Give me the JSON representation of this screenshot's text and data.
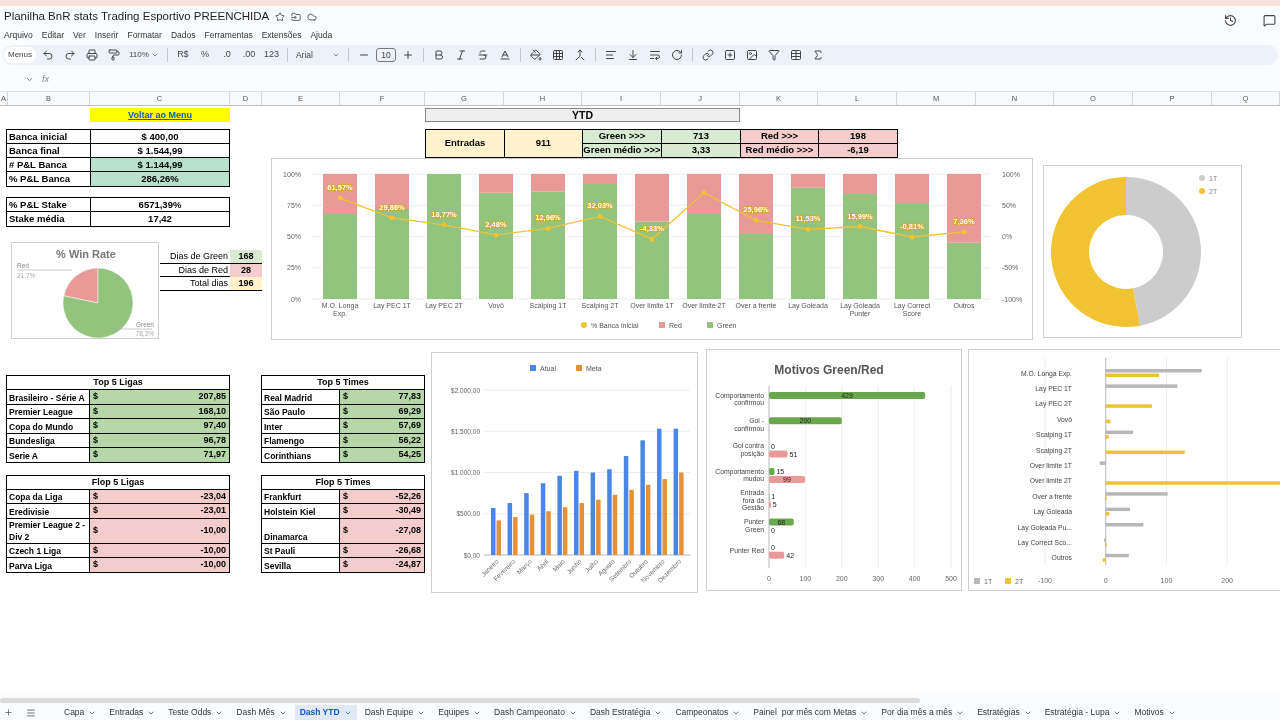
{
  "title": "Planilha BnR stats Trading Esportivo PREENCHIDA",
  "menu": [
    "Arquivo",
    "Editar",
    "Ver",
    "Inserir",
    "Formatar",
    "Dados",
    "Ferramentas",
    "Extensões",
    "Ajuda"
  ],
  "toolbar": {
    "menus": "Menus",
    "zoom": "110%",
    "currency": "R$",
    "percent": "%",
    "dec_less": ".0",
    "dec_more": ".00",
    "format": "123",
    "font": "Arial",
    "size": "10"
  },
  "formula_bar": {
    "label": "fx"
  },
  "columns": [
    "A",
    "B",
    "C",
    "D",
    "E",
    "F",
    "G",
    "H",
    "I",
    "J",
    "K",
    "L",
    "M",
    "N",
    "O",
    "P",
    "Q"
  ],
  "menu_link": "Voltar ao Menu",
  "bank_table": [
    {
      "label": "Banca inicial",
      "value": "$ 400,00",
      "highlight": false
    },
    {
      "label": "Banca final",
      "value": "$ 1.544,99",
      "highlight": false
    },
    {
      "label": "# P&L Banca",
      "value": "$ 1.144,99",
      "highlight": true
    },
    {
      "label": "% P&L Banca",
      "value": "286,26%",
      "highlight": true
    }
  ],
  "stake_table": [
    {
      "label": "% P&L Stake",
      "value": "6571,39%",
      "highlight": false
    },
    {
      "label": "Stake média",
      "value": "17,42",
      "highlight": false
    }
  ],
  "days_table": [
    {
      "label": "Dias de Green",
      "value": "168",
      "color": "#d9ead3"
    },
    {
      "label": "Dias de Red",
      "value": "28",
      "color": "#f4cccc"
    },
    {
      "label": "Total dias",
      "value": "196",
      "color": "#fff2cc"
    }
  ],
  "ytd": {
    "title": "YTD",
    "entries_label": "Entradas",
    "entries_value": "911",
    "green": [
      {
        "label": "Green >>>",
        "value": "713"
      },
      {
        "label": "Green médio >>>",
        "value": "3,33"
      }
    ],
    "red": [
      {
        "label": "Red >>>",
        "value": "198"
      },
      {
        "label": "Red médio >>>",
        "value": "-6,19"
      }
    ]
  },
  "win_rate": {
    "chart_data": {
      "type": "pie",
      "title": "% Win Rate",
      "categories": [
        "Red",
        "Green"
      ],
      "values": [
        21.7,
        78.3
      ],
      "value_labels": [
        "21,7%",
        "78,3%"
      ],
      "colors": [
        "#ea9999",
        "#93c47d"
      ]
    }
  },
  "main_chart": {
    "chart_data": {
      "type": "bar",
      "stacked": true,
      "categories": [
        "M.O. Longa Exp.",
        "Lay PEC 1T",
        "Lay PEC 2T",
        "Vovô",
        "Scalping 1T",
        "Scalping 2T",
        "Over limite 1T",
        "Over limite 2T",
        "Over a frente",
        "Lay Goleada",
        "Lay Goleada Punter",
        "Lay Correct Score",
        "Outros"
      ],
      "series": [
        {
          "name": "% Banca inicial",
          "type": "line",
          "axis": "y2",
          "color": "#f1c232",
          "values": [
            61.57,
            29.86,
            18.77,
            2.48,
            12.96,
            32.03,
            -4.33,
            70,
            25.96,
            11.53,
            15.99,
            -0.81,
            7.36
          ],
          "value_labels": [
            "61,57%",
            "29,86%",
            "18,77%",
            "2,48%",
            "12,96%",
            "32,03%",
            "-4,33%",
            null,
            "25,96%",
            "11,53%",
            "15,99%",
            "-0,81%",
            "7,36%"
          ]
        },
        {
          "name": "Red",
          "type": "bar",
          "color": "#ea9999",
          "values": [
            32,
            28,
            0,
            15,
            14,
            8,
            38,
            32,
            48,
            11,
            16,
            24,
            55
          ]
        },
        {
          "name": "Green",
          "type": "bar",
          "color": "#93c47d",
          "values": [
            68,
            72,
            100,
            85,
            86,
            92,
            62,
            68,
            52,
            89,
            84,
            76,
            45
          ]
        }
      ],
      "grid": true,
      "legend": true,
      "ylim": [
        0,
        100
      ],
      "yticks": [
        {
          "value": 0,
          "label": "0%"
        },
        {
          "value": 25,
          "label": "25%"
        },
        {
          "value": 50,
          "label": "50%"
        },
        {
          "value": 75,
          "label": "75%"
        },
        {
          "value": 100,
          "label": "100%"
        }
      ],
      "y2lim": [
        -100,
        100
      ],
      "y2ticks": [
        {
          "value": -100,
          "label": "-100%"
        },
        {
          "value": -50,
          "label": "-50%"
        },
        {
          "value": 0,
          "label": "0%"
        },
        {
          "value": 50,
          "label": "50%"
        },
        {
          "value": 100,
          "label": "100%"
        }
      ]
    }
  },
  "donut": {
    "legend": [
      {
        "label": "1T",
        "color": "#cccccc"
      },
      {
        "label": "2T",
        "color": "#f1c232"
      }
    ]
  },
  "top_tables": [
    {
      "title": "Top 5 Ligas",
      "kind": "top",
      "rows": [
        {
          "name": "Brasileiro - Série A",
          "currency": "$",
          "value": "207,85"
        },
        {
          "name": "Premier League",
          "currency": "$",
          "value": "168,10"
        },
        {
          "name": "Copa do Mundo",
          "currency": "$",
          "value": "97,40"
        },
        {
          "name": "Bundesliga",
          "currency": "$",
          "value": "96,78"
        },
        {
          "name": "Serie A",
          "currency": "$",
          "value": "71,97"
        }
      ]
    },
    {
      "title": "Top 5 Times",
      "kind": "top",
      "rows": [
        {
          "name": "Real Madrid",
          "currency": "$",
          "value": "77,83"
        },
        {
          "name": "São Paulo",
          "currency": "$",
          "value": "69,29"
        },
        {
          "name": "Inter",
          "currency": "$",
          "value": "57,69"
        },
        {
          "name": "Flamengo",
          "currency": "$",
          "value": "56,22"
        },
        {
          "name": "Corinthians",
          "currency": "$",
          "value": "54,25"
        }
      ]
    }
  ],
  "flop_tables": [
    {
      "title": "Flop 5 Ligas",
      "kind": "flop",
      "rows": [
        {
          "name": "Copa da Liga",
          "currency": "$",
          "value": "-23,04"
        },
        {
          "name": "Eredivisie",
          "currency": "$",
          "value": "-23,01"
        },
        {
          "name": "Premier League 2 - Div 2",
          "currency": "$",
          "value": "-10,00"
        },
        {
          "name": "Czech 1 Liga",
          "currency": "$",
          "value": "-10,00"
        },
        {
          "name": "Parva Liga",
          "currency": "$",
          "value": "-10,00"
        }
      ]
    },
    {
      "title": "Flop 5 Times",
      "kind": "flop",
      "rows": [
        {
          "name": "Frankfurt",
          "currency": "$",
          "value": "-52,26"
        },
        {
          "name": "Holstein Kiel",
          "currency": "$",
          "value": "-30,49"
        },
        {
          "name": "Dinamarca",
          "currency": "$",
          "value": "-27,08"
        },
        {
          "name": "St Pauli",
          "currency": "$",
          "value": "-26,68"
        },
        {
          "name": "Sevilla",
          "currency": "$",
          "value": "-24,87"
        }
      ]
    }
  ],
  "monthly_chart": {
    "chart_data": {
      "type": "bar",
      "categories": [
        "Janeiro",
        "Fevereiro",
        "Março",
        "Abril",
        "Maio",
        "Junho",
        "Julho",
        "Agosto",
        "Setembro",
        "Outubro",
        "Novembro",
        "Dezembro"
      ],
      "series": [
        {
          "name": "Atual",
          "color": "#4a86e8",
          "values": [
            570,
            630,
            750,
            870,
            960,
            1020,
            1000,
            1040,
            1200,
            1390,
            1530,
            1530
          ]
        },
        {
          "name": "Meta",
          "color": "#e69138",
          "values": [
            420,
            460,
            490,
            530,
            580,
            630,
            670,
            730,
            790,
            850,
            920,
            1000
          ]
        }
      ],
      "grid": true,
      "legend": true,
      "ylim": [
        0,
        2000
      ],
      "yticks": [
        {
          "value": 0,
          "label": "$0,00"
        },
        {
          "value": 500,
          "label": "$500,00"
        },
        {
          "value": 1000,
          "label": "$1.000,00"
        },
        {
          "value": 1500,
          "label": "$1.500,00"
        },
        {
          "value": 2000,
          "label": "$2.000,00"
        }
      ]
    }
  },
  "motivos_chart": {
    "chart_data": {
      "type": "bar",
      "orientation": "horizontal",
      "title": "Motivos Green/Red",
      "data_labels": true,
      "categories": [
        "Comportamento confirmou",
        "Gol - confirmou",
        "Gol contra posição",
        "Comportamento mudou",
        "Entrada fora da Gestão",
        "Punter Green",
        "Punter Red"
      ],
      "series": [
        {
          "color": "#6aa84f",
          "values": [
            429,
            200,
            0,
            15,
            1,
            68,
            0
          ]
        },
        {
          "color": "#ea9999",
          "values": [
            null,
            null,
            51,
            99,
            5,
            0,
            42
          ]
        }
      ],
      "grid": true,
      "xlim": [
        0,
        500
      ],
      "xticks": [
        0,
        100,
        200,
        300,
        400,
        500
      ]
    }
  },
  "half_chart": {
    "chart_data": {
      "type": "bar",
      "orientation": "horizontal",
      "categories": [
        "M.O. Longa Exp.",
        "Lay PEC 1T",
        "Lay PEC 2T",
        "Vovô",
        "Scalping 1T",
        "Scalping 2T",
        "Over limite 1T",
        "Over limite 2T",
        "Over a frente",
        "Lay Goleada",
        "Lay Goleada Pu...",
        "Lay Correct Sco...",
        "Outros"
      ],
      "series": [
        {
          "name": "1T",
          "color": "#b7b7b7",
          "values": [
            158,
            118,
            0,
            0,
            45,
            0,
            -10,
            0,
            102,
            40,
            62,
            -3,
            38
          ]
        },
        {
          "name": "2T",
          "color": "#f1c232",
          "values": [
            88,
            0,
            76,
            8,
            5,
            130,
            0,
            287,
            2,
            6,
            0,
            2,
            -5
          ]
        }
      ],
      "grid": true,
      "legend": true,
      "xlim": [
        -100,
        287
      ],
      "xticks": [
        -100,
        0,
        100,
        200
      ]
    }
  },
  "tabs": [
    {
      "label": "Capa",
      "selected": false
    },
    {
      "label": "Entradas",
      "selected": false
    },
    {
      "label": "Teste Odds",
      "selected": false
    },
    {
      "label": "Dash Mês",
      "selected": false
    },
    {
      "label": "Dash YTD",
      "selected": true
    },
    {
      "label": "Dash Equipe",
      "selected": false
    },
    {
      "label": "Equipes",
      "selected": false
    },
    {
      "label": "Dash Campeonato",
      "selected": false
    },
    {
      "label": "Dash Estratégia",
      "selected": false
    },
    {
      "label": "Campeonatos",
      "selected": false
    },
    {
      "label": "Painel  por mês com Metas",
      "selected": false
    },
    {
      "label": "Por dia mês a mês",
      "selected": false
    },
    {
      "label": "Estratégias",
      "selected": false
    },
    {
      "label": "Estratégia - Lupa",
      "selected": false
    },
    {
      "label": "Motivos",
      "selected": false
    }
  ]
}
